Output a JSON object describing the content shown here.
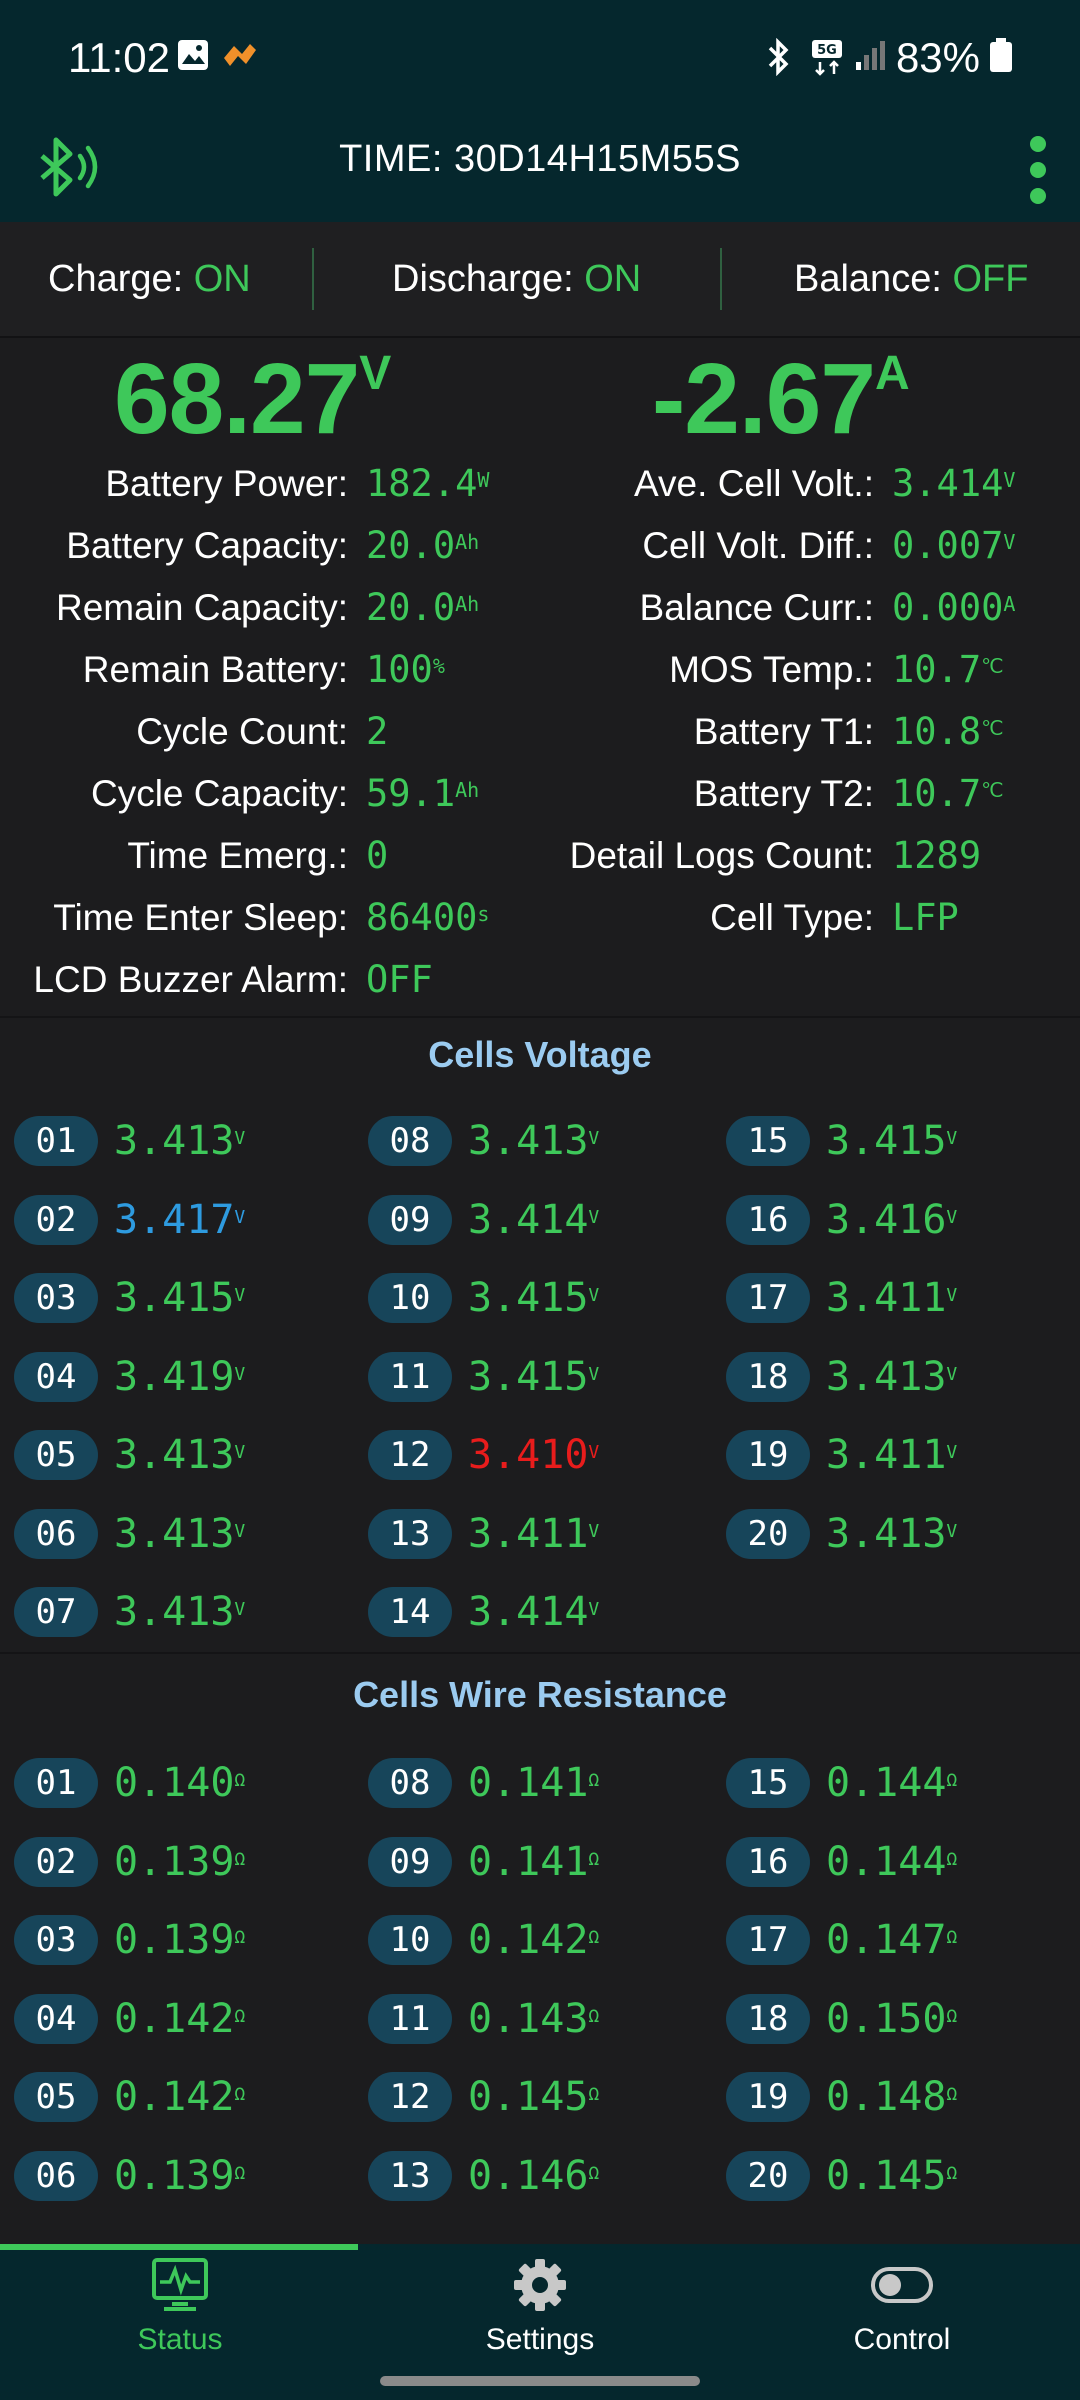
{
  "status_bar": {
    "time": "11:02",
    "battery": "83%"
  },
  "app_bar": {
    "title": "TIME: 30D14H15M55S"
  },
  "switches": [
    {
      "label": "Charge: ",
      "value": "ON"
    },
    {
      "label": "Discharge: ",
      "value": "ON"
    },
    {
      "label": "Balance: ",
      "value": "OFF"
    }
  ],
  "readings": {
    "voltage": "68.27",
    "voltage_unit": "V",
    "current": "-2.67",
    "current_unit": "A"
  },
  "left_stats": [
    {
      "label": "Battery Power:",
      "value": "182.4",
      "unit": "W"
    },
    {
      "label": "Battery Capacity:",
      "value": "20.0",
      "unit": "Ah"
    },
    {
      "label": "Remain Capacity:",
      "value": "20.0",
      "unit": "Ah"
    },
    {
      "label": "Remain Battery:",
      "value": "100",
      "unit": "%"
    },
    {
      "label": "Cycle Count:",
      "value": "2",
      "unit": ""
    },
    {
      "label": "Cycle Capacity:",
      "value": "59.1",
      "unit": "Ah"
    },
    {
      "label": "Time Emerg.:",
      "value": "0",
      "unit": ""
    },
    {
      "label": "Time Enter Sleep:",
      "value": "86400",
      "unit": "s"
    },
    {
      "label": "LCD Buzzer Alarm:",
      "value": "OFF",
      "unit": ""
    }
  ],
  "right_stats": [
    {
      "label": "Ave. Cell Volt.:",
      "value": "3.414",
      "unit": "V"
    },
    {
      "label": "Cell Volt. Diff.:",
      "value": "0.007",
      "unit": "V"
    },
    {
      "label": "Balance Curr.:",
      "value": "0.000",
      "unit": "A"
    },
    {
      "label": "MOS Temp.:",
      "value": "10.7",
      "unit": "℃"
    },
    {
      "label": "Battery T1:",
      "value": "10.8",
      "unit": "℃"
    },
    {
      "label": "Battery T2:",
      "value": "10.7",
      "unit": "℃"
    },
    {
      "label": "Detail Logs Count:",
      "value": "1289",
      "unit": ""
    },
    {
      "label": "Cell Type:",
      "value": "LFP",
      "unit": ""
    }
  ],
  "cells_voltage": {
    "title": "Cells Voltage",
    "unit": "V",
    "cells": [
      {
        "id": "01",
        "value": "3.413",
        "state": "normal"
      },
      {
        "id": "02",
        "value": "3.417",
        "state": "max"
      },
      {
        "id": "03",
        "value": "3.415",
        "state": "normal"
      },
      {
        "id": "04",
        "value": "3.419",
        "state": "normal"
      },
      {
        "id": "05",
        "value": "3.413",
        "state": "normal"
      },
      {
        "id": "06",
        "value": "3.413",
        "state": "normal"
      },
      {
        "id": "07",
        "value": "3.413",
        "state": "normal"
      },
      {
        "id": "08",
        "value": "3.413",
        "state": "normal"
      },
      {
        "id": "09",
        "value": "3.414",
        "state": "normal"
      },
      {
        "id": "10",
        "value": "3.415",
        "state": "normal"
      },
      {
        "id": "11",
        "value": "3.415",
        "state": "normal"
      },
      {
        "id": "12",
        "value": "3.410",
        "state": "min"
      },
      {
        "id": "13",
        "value": "3.411",
        "state": "normal"
      },
      {
        "id": "14",
        "value": "3.414",
        "state": "normal"
      },
      {
        "id": "15",
        "value": "3.415",
        "state": "normal"
      },
      {
        "id": "16",
        "value": "3.416",
        "state": "normal"
      },
      {
        "id": "17",
        "value": "3.411",
        "state": "normal"
      },
      {
        "id": "18",
        "value": "3.413",
        "state": "normal"
      },
      {
        "id": "19",
        "value": "3.411",
        "state": "normal"
      },
      {
        "id": "20",
        "value": "3.413",
        "state": "normal"
      }
    ]
  },
  "cells_resistance": {
    "title": "Cells Wire Resistance",
    "unit": "Ω",
    "cells": [
      {
        "id": "01",
        "value": "0.140"
      },
      {
        "id": "02",
        "value": "0.139"
      },
      {
        "id": "03",
        "value": "0.139"
      },
      {
        "id": "04",
        "value": "0.142"
      },
      {
        "id": "05",
        "value": "0.142"
      },
      {
        "id": "06",
        "value": "0.139"
      },
      {
        "id": "08",
        "value": "0.141"
      },
      {
        "id": "09",
        "value": "0.141"
      },
      {
        "id": "10",
        "value": "0.142"
      },
      {
        "id": "11",
        "value": "0.143"
      },
      {
        "id": "12",
        "value": "0.145"
      },
      {
        "id": "13",
        "value": "0.146"
      },
      {
        "id": "15",
        "value": "0.144"
      },
      {
        "id": "16",
        "value": "0.144"
      },
      {
        "id": "17",
        "value": "0.147"
      },
      {
        "id": "18",
        "value": "0.150"
      },
      {
        "id": "19",
        "value": "0.148"
      },
      {
        "id": "20",
        "value": "0.145"
      }
    ]
  },
  "bottom_nav": [
    {
      "label": "Status",
      "icon": "pulse-monitor-icon",
      "active": true
    },
    {
      "label": "Settings",
      "icon": "gear-icon",
      "active": false
    },
    {
      "label": "Control",
      "icon": "toggle-icon",
      "active": false
    }
  ],
  "colors": {
    "accent_green": "#3ec85a",
    "max_blue": "#2e9be0",
    "min_red": "#e81c1c",
    "header_bg": "#05272d",
    "section_title": "#9bcbf0"
  }
}
